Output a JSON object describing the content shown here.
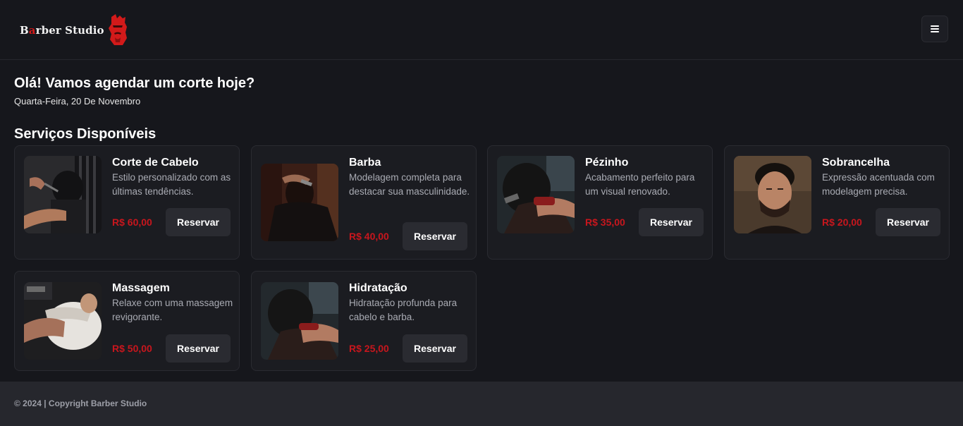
{
  "header": {
    "logo": {
      "text_before": "B",
      "text_scissor": "a",
      "text_after": "rber Studio"
    },
    "menu_icon": "hamburger-menu-icon"
  },
  "main": {
    "greeting": "Olá! Vamos agendar um corte hoje?",
    "date": "Quarta-Feira, 20 De Novembro",
    "section_title": "Serviços Disponíveis"
  },
  "services": [
    {
      "name": "Corte de Cabelo",
      "description": "Estilo personalizado com as últimas tendências.",
      "price": "R$ 60,00",
      "button": "Reservar"
    },
    {
      "name": "Barba",
      "description": "Modelagem completa para destacar sua masculinidade.",
      "price": "R$ 40,00",
      "button": "Reservar"
    },
    {
      "name": "Pézinho",
      "description": "Acabamento perfeito para um visual renovado.",
      "price": "R$ 35,00",
      "button": "Reservar"
    },
    {
      "name": "Sobrancelha",
      "description": "Expressão acentuada com modelagem precisa.",
      "price": "R$ 20,00",
      "button": "Reservar"
    },
    {
      "name": "Massagem",
      "description": "Relaxe com uma massagem revigorante.",
      "price": "R$ 50,00",
      "button": "Reservar"
    },
    {
      "name": "Hidratação",
      "description": "Hidratação profunda para cabelo e barba.",
      "price": "R$ 25,00",
      "button": "Reservar"
    }
  ],
  "footer": {
    "text": "© 2024 | Copyright Barber Studio"
  },
  "colors": {
    "background": "#16171c",
    "card": "#1b1c21",
    "accent_price": "#c8161d",
    "button": "#2a2b31",
    "footer": "#26272d"
  }
}
